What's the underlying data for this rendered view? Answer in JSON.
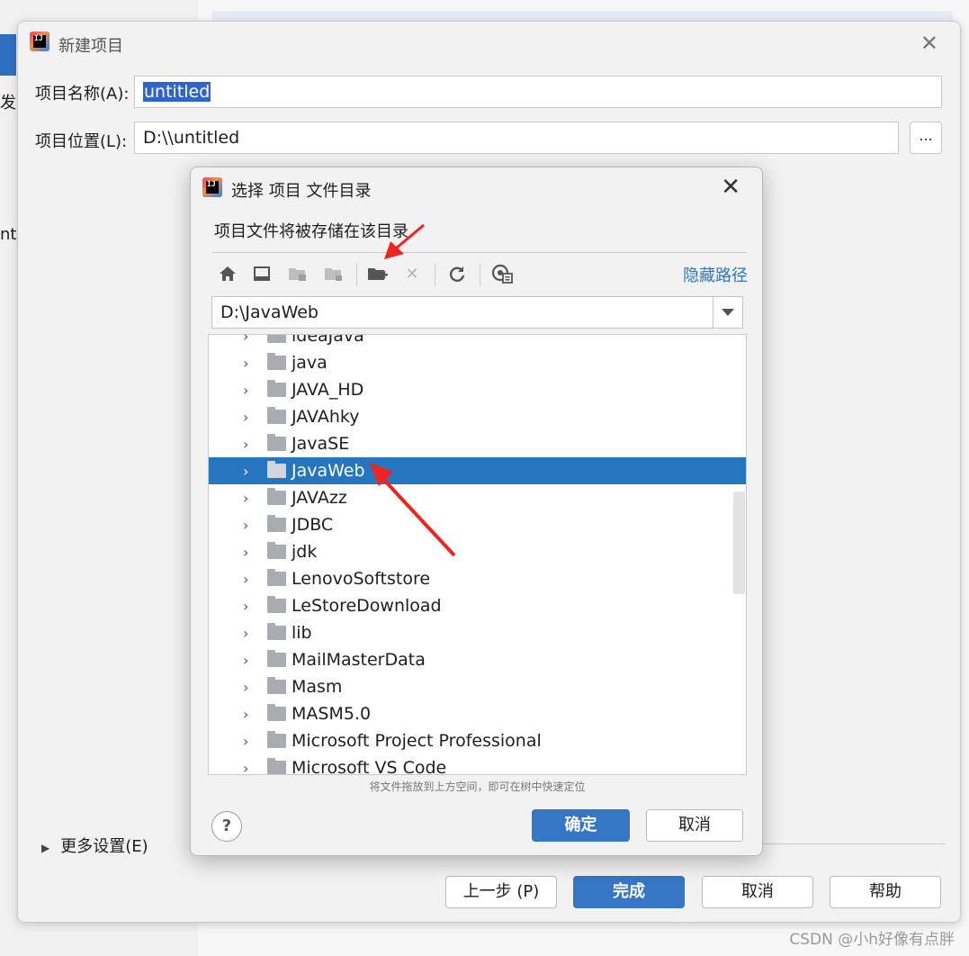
{
  "background": {
    "left_fragment_1": "发",
    "left_fragment_2": "nte"
  },
  "new_project": {
    "title": "新建项目",
    "name_label": "项目名称(A):",
    "name_value": "untitled",
    "location_label": "项目位置(L):",
    "location_value": "D:\\\\untitled",
    "browse_label": "...",
    "more_settings": "更多设置(E)",
    "buttons": {
      "prev": "上一步 (P)",
      "finish": "完成",
      "cancel": "取消",
      "help": "帮助"
    }
  },
  "chooser": {
    "title": "选择 项目 文件目录",
    "description": "项目文件将被存储在该目录",
    "hide_path": "隐藏路径",
    "path_value": "D:\\JavaWeb",
    "toolbar_icons": [
      "home-icon",
      "desktop-icon",
      "project-folder-icon",
      "module-folder-icon",
      "new-folder-icon",
      "delete-icon",
      "refresh-icon",
      "show-hidden-icon"
    ],
    "folders": [
      "ideaJava",
      "java",
      "JAVA_HD",
      "JAVAhky",
      "JavaSE",
      "JavaWeb",
      "JAVAzz",
      "JDBC",
      "jdk",
      "LenovoSoftstore",
      "LeStoreDownload",
      "lib",
      "MailMasterData",
      "Masm",
      "MASM5.0",
      "Microsoft Project Professional",
      "Microsoft VS Code"
    ],
    "selected_folder": "JavaWeb",
    "hint": "将文件拖放到上方空间，即可在树中快速定位",
    "help_label": "?",
    "ok_label": "确定",
    "cancel_label": "取消"
  },
  "watermark": "CSDN @小h好像有点胖",
  "colors": {
    "accent": "#2675bf",
    "primary_button": "#3576c5",
    "link": "#2e75c3",
    "annotation_arrow": "#f0241e"
  }
}
